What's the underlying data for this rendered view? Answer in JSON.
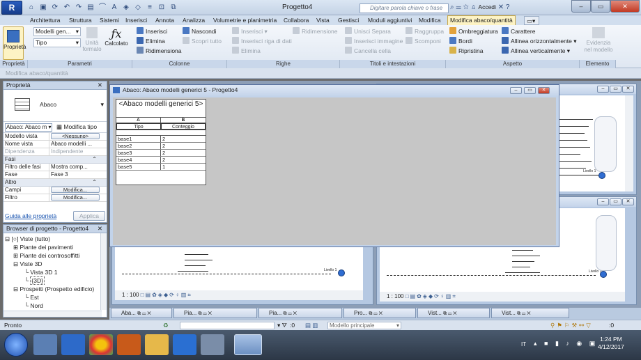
{
  "app": {
    "logo": "R",
    "title": "Progetto4",
    "search_placeholder": "Digitare parola chiave o frase",
    "accedi": "Accedi"
  },
  "tabs": [
    "Architettura",
    "Struttura",
    "Sistemi",
    "Inserisci",
    "Annota",
    "Analizza",
    "Volumetrie e planimetria",
    "Collabora",
    "Vista",
    "Gestisci",
    "Moduli aggiuntivi",
    "Modifica",
    "Modifica abaco/quantità"
  ],
  "ribbon": {
    "proprieta": "Proprietà",
    "modelli": "Modelli gen...",
    "tipo": "Tipo",
    "unita": "Unità formato",
    "calcolato": "Calcolato",
    "col_inserisci": "Inserisci",
    "col_elimina": "Elimina",
    "col_ridim": "Ridimensiona",
    "nascondi": "Nascondi",
    "scopri": "Scopri tutto",
    "r_inserisci": "Inserisci",
    "r_ridim": "Ridimensione",
    "r_inserisci_riga": "Inserisci riga di dati",
    "r_elimina": "Elimina",
    "unisci": "Unisci Separa",
    "raggruppa": "Raggruppa",
    "ins_imm": "Inserisci immagine",
    "scomponi": "Scomponi",
    "cancella": "Cancella cella",
    "ombreggiatura": "Ombreggiatura",
    "carattere": "Carattere",
    "bordi": "Bordi",
    "allinea_o": "Allinea orizzontalmente",
    "ripristina": "Ripristina",
    "allinea_v": "Allinea verticalmente",
    "evidenzia": "Evidenzia nel modello",
    "labels": [
      "Proprietà",
      "Parametri",
      "Colonne",
      "Righe",
      "Titoli e intestazioni",
      "Aspetto",
      "Elemento"
    ]
  },
  "context_bar": "Modifica abaco/quantità",
  "properties": {
    "title": "Proprietà",
    "type_name": "Abaco",
    "selector": "Abaco: Abaco m",
    "edit_type": "Modifica tipo",
    "rows": [
      [
        "Modello vista",
        "<Nessuno>"
      ],
      [
        "Nome vista",
        "Abaco modelli ..."
      ],
      [
        "Dipendenza",
        "Indipendente"
      ]
    ],
    "sec_fasi": "Fasi",
    "fasi": [
      [
        "Filtro delle fasi",
        "Mostra comp..."
      ],
      [
        "Fase",
        "Fase 3"
      ]
    ],
    "sec_altro": "Altro",
    "altro": [
      [
        "Campi",
        "Modifica..."
      ],
      [
        "Filtro",
        "Modifica..."
      ]
    ],
    "help": "Guida alle proprietà",
    "apply": "Applica"
  },
  "browser": {
    "title": "Browser di progetto - Progetto4",
    "items": [
      "Viste (tutto)",
      "Piante dei pavimenti",
      "Piante dei controsoffitti",
      "Viste 3D",
      "Vista 3D 1",
      "{3D}",
      "Prospetti (Prospetto edificio)",
      "Est",
      "Nord"
    ]
  },
  "schedule": {
    "window_title": "Abaco: Abaco modelli generici 5 - Progetto4",
    "heading": "<Abaco modelli generici 5>",
    "col_a": "A",
    "col_b": "B",
    "h_tipo": "Tipo",
    "h_conteggio": "Conteggio",
    "rows": [
      [
        "base1",
        "2"
      ],
      [
        "base2",
        "2"
      ],
      [
        "base3",
        "2"
      ],
      [
        "base4",
        "2"
      ],
      [
        "base5",
        "1"
      ]
    ]
  },
  "views": {
    "scale": "1 : 100",
    "label": "Livello 1"
  },
  "doctabs": [
    "Aba...",
    "Pia...",
    "Pia...",
    "Pro...",
    "Vist...",
    "Vist..."
  ],
  "status": {
    "ready": "Pronto",
    "zero": ":0",
    "model": "Modello principale",
    "filter": ":0"
  },
  "clock": {
    "time": "1:24 PM",
    "date": "4/12/2017",
    "lang": "IT"
  }
}
